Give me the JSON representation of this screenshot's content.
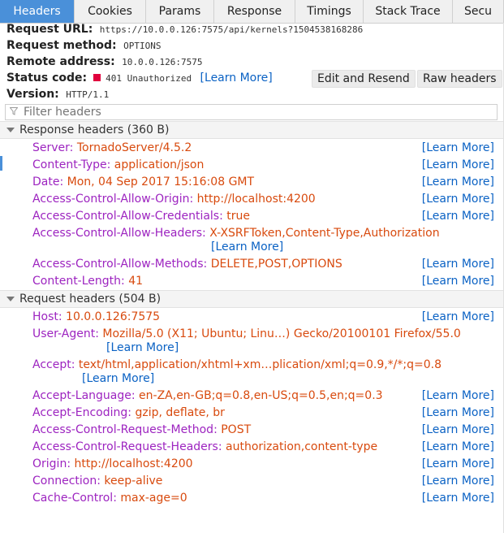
{
  "tabs": [
    {
      "label": "Headers",
      "active": true
    },
    {
      "label": "Cookies",
      "active": false
    },
    {
      "label": "Params",
      "active": false
    },
    {
      "label": "Response",
      "active": false
    },
    {
      "label": "Timings",
      "active": false
    },
    {
      "label": "Stack Trace",
      "active": false
    },
    {
      "label": "Secu",
      "active": false
    }
  ],
  "summary": {
    "url_label": "Request URL:",
    "url": "https://10.0.0.126:7575/api/kernels?1504538168286",
    "method_label": "Request method:",
    "method": "OPTIONS",
    "remote_label": "Remote address:",
    "remote": "10.0.0.126:7575",
    "status_label": "Status code:",
    "status": "401 Unauthorized",
    "status_color": "#e0003d",
    "learn_more": "[Learn More]",
    "version_label": "Version:",
    "version": "HTTP/1.1"
  },
  "actions": {
    "edit_resend": "Edit and Resend",
    "raw_headers": "Raw headers"
  },
  "filter": {
    "placeholder": "Filter headers"
  },
  "learn_more": "[Learn More]",
  "response_headers": {
    "title": "Response headers (360 B)",
    "items": [
      {
        "name": "Server:",
        "value": "TornadoServer/4.5.2"
      },
      {
        "name": "Content-Type:",
        "value": "application/json"
      },
      {
        "name": "Date:",
        "value": "Mon, 04 Sep 2017 15:16:08 GMT"
      },
      {
        "name": "Access-Control-Allow-Origin:",
        "value": "http://localhost:4200"
      },
      {
        "name": "Access-Control-Allow-Credentials:",
        "value": "true"
      },
      {
        "name": "Access-Control-Allow-Headers:",
        "value": "X-XSRFToken,Content-Type,Authorization"
      },
      {
        "name": "Access-Control-Allow-Methods:",
        "value": "DELETE,POST,OPTIONS"
      },
      {
        "name": "Content-Length:",
        "value": "41"
      }
    ]
  },
  "request_headers": {
    "title": "Request headers (504 B)",
    "items": [
      {
        "name": "Host:",
        "value": "10.0.0.126:7575"
      },
      {
        "name": "User-Agent:",
        "value": "Mozilla/5.0 (X11; Ubuntu; Linu…) Gecko/20100101 Firefox/55.0"
      },
      {
        "name": "Accept:",
        "value": "text/html,application/xhtml+xm…plication/xml;q=0.9,*/*;q=0.8"
      },
      {
        "name": "Accept-Language:",
        "value": "en-ZA,en-GB;q=0.8,en-US;q=0.5,en;q=0.3"
      },
      {
        "name": "Accept-Encoding:",
        "value": "gzip, deflate, br"
      },
      {
        "name": "Access-Control-Request-Method:",
        "value": "POST"
      },
      {
        "name": "Access-Control-Request-Headers:",
        "value": "authorization,content-type"
      },
      {
        "name": "Origin:",
        "value": "http://localhost:4200"
      },
      {
        "name": "Connection:",
        "value": "keep-alive"
      },
      {
        "name": "Cache-Control:",
        "value": "max-age=0"
      }
    ]
  },
  "colors": {
    "accent": "#4a90d9",
    "header_name": "#9d24c0",
    "header_value": "#d84a0e",
    "link": "#0b62c4"
  }
}
